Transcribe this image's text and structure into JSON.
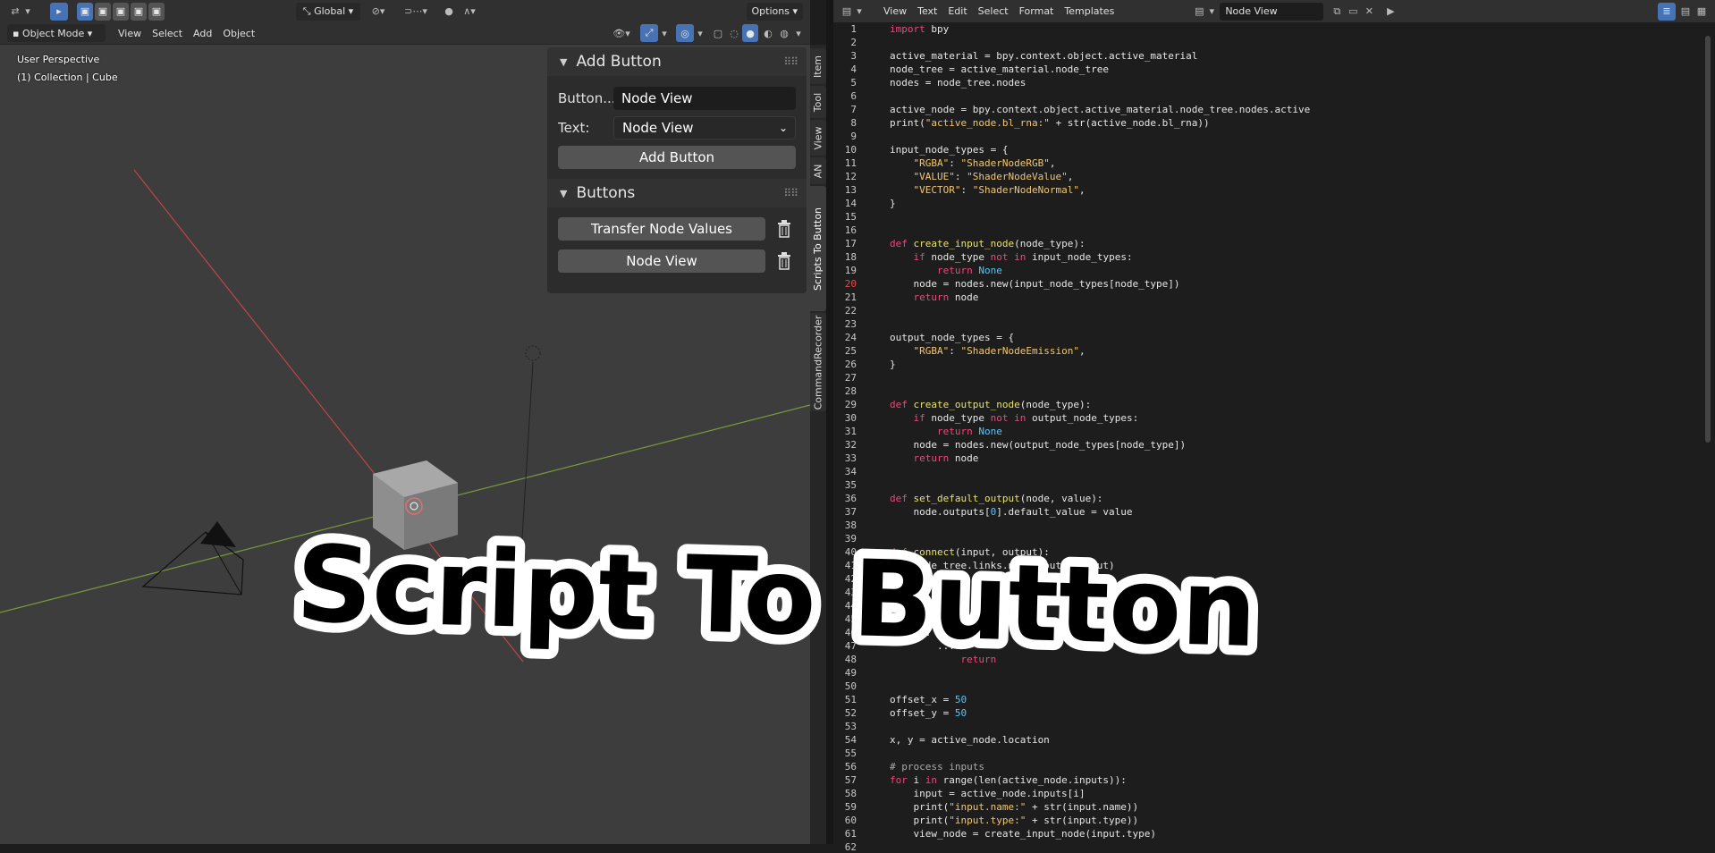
{
  "viewport": {
    "header": {
      "options_label": "Options",
      "transform_label": "Global"
    },
    "header2": {
      "mode_label": "Object Mode",
      "menus": [
        "View",
        "Select",
        "Add",
        "Object"
      ]
    },
    "info": {
      "perspective": "User Perspective",
      "collection": "(1) Collection | Cube"
    }
  },
  "panel": {
    "add_button": {
      "title": "Add Button",
      "button_label": "Button...",
      "button_value": "Node View",
      "text_label": "Text:",
      "text_value": "Node View",
      "action": "Add Button"
    },
    "buttons": {
      "title": "Buttons",
      "items": [
        {
          "label": "Transfer Node Values"
        },
        {
          "label": "Node View"
        }
      ]
    }
  },
  "tabs": [
    "Item",
    "Tool",
    "View",
    "AN",
    "Scripts To Button",
    "CommandRecorder"
  ],
  "editor": {
    "menus": [
      "View",
      "Text",
      "Edit",
      "Select",
      "Format",
      "Templates"
    ],
    "datablock": "Node View",
    "lines": [
      "import bpy",
      "",
      "active_material = bpy.context.object.active_material",
      "node_tree = active_material.node_tree",
      "nodes = node_tree.nodes",
      "",
      "active_node = bpy.context.object.active_material.node_tree.nodes.active",
      "print(\"active_node.bl_rna:\" + str(active_node.bl_rna))",
      "",
      "input_node_types = {",
      "    \"RGBA\": \"ShaderNodeRGB\",",
      "    \"VALUE\": \"ShaderNodeValue\",",
      "    \"VECTOR\": \"ShaderNodeNormal\",",
      "}",
      "",
      "",
      "def create_input_node(node_type):",
      "    if node_type not in input_node_types:",
      "        return None",
      "    node = nodes.new(input_node_types[node_type])",
      "    return node",
      "",
      "",
      "output_node_types = {",
      "    \"RGBA\": \"ShaderNodeEmission\",",
      "}",
      "",
      "",
      "def create_output_node(node_type):",
      "    if node_type not in output_node_types:",
      "        return None",
      "    node = nodes.new(output_node_types[node_type])",
      "    return node",
      "",
      "",
      "def set_default_output(node, value):",
      "    node.outputs[0].default_value = value",
      "",
      "",
      "def connect(input, output):",
      "    node_tree.links.new(input, output)",
      "",
      "",
      "def ...",
      "    ...",
      "    ...",
      "        ...",
      "            return",
      "",
      "",
      "offset_x = 50",
      "offset_y = 50",
      "",
      "x, y = active_node.location",
      "",
      "# process inputs",
      "for i in range(len(active_node.inputs)):",
      "    input = active_node.inputs[i]",
      "    print(\"input.name:\" + str(input.name))",
      "    print(\"input.type:\" + str(input.type))",
      "    view_node = create_input_node(input.type)",
      "    ..."
    ],
    "current_line": 20
  },
  "overlay": {
    "title": "Script To Button"
  },
  "colors": {
    "accent": "#4772b3",
    "keyword": "#e84a7a",
    "string": "#f0c674",
    "number": "#55c5ff",
    "def": "#e6e26e"
  }
}
